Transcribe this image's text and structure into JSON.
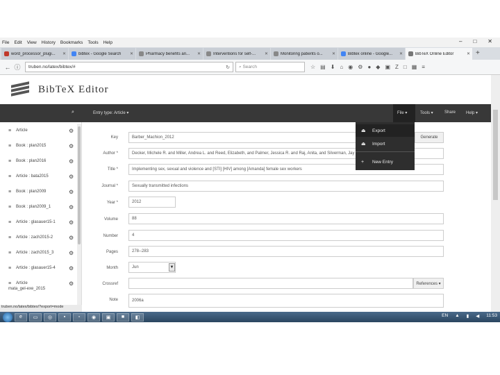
{
  "browser": {
    "menu": [
      "File",
      "Edit",
      "View",
      "History",
      "Bookmarks",
      "Tools",
      "Help"
    ],
    "tabs": [
      {
        "label": "word_processor_plugi...",
        "color": "#c0392b"
      },
      {
        "label": "bibtex - Google Search",
        "color": "#4285f4"
      },
      {
        "label": "Pharmacy benefits an...",
        "color": "#888888"
      },
      {
        "label": "Interventions for self-...",
        "color": "#888888"
      },
      {
        "label": "Monitoring patients o...",
        "color": "#888888"
      },
      {
        "label": "Bibtex online - Google...",
        "color": "#4285f4"
      },
      {
        "label": "BibTeX Online Editor",
        "color": "#777777"
      }
    ],
    "url": "truben.no/latex/bibtex/#",
    "search_placeholder": "Search"
  },
  "app": {
    "title": "BibTeX Editor",
    "entry_type_label": "Entry type: Article ▾",
    "nav": {
      "file": "File ▾",
      "tools": "Tools ▾",
      "share": "Share",
      "help": "Help ▾"
    },
    "file_menu": {
      "export": "Export",
      "import": "Import",
      "new_entry": "New Entry"
    }
  },
  "entries": [
    {
      "label": "Article"
    },
    {
      "label": "Book : plan2015"
    },
    {
      "label": "Book : plan2016"
    },
    {
      "label": "Article : bata2015"
    },
    {
      "label": "Book : plan2009"
    },
    {
      "label": "Book : plan2009_1"
    },
    {
      "label": "Article : glasauer15-1"
    },
    {
      "label": "Article : zach2015-2"
    },
    {
      "label": "Article : zach2015_3"
    },
    {
      "label": "Article : glasauer15-4"
    },
    {
      "label": "Article",
      "sub": "mata_gel-exe_2015"
    }
  ],
  "form": {
    "key_label": "Key",
    "key_value": "Barber_Machion_2012",
    "generate_label": "Generate",
    "author_label": "Author *",
    "author_value": "Decker, Michele R. and Miller, Andrea L. and Reed, Elizabeth, and Palmer, Jessica R. and Raj, Anita, and Silverman, Jay G. and Decker, Michele R.",
    "title_label": "Title *",
    "title_value": "Implementing sex, sexual and violence and [STI] [HIV] among [Amanda] female sex workers",
    "journal_label": "Journal *",
    "journal_value": "Sexually transmitted infections",
    "year_label": "Year *",
    "year_value": "2012",
    "volume_label": "Volume",
    "volume_value": "88",
    "number_label": "Number",
    "number_value": "4",
    "pages_label": "Pages",
    "pages_value": "278--283",
    "month_label": "Month",
    "month_value": "Jun",
    "crossref_label": "Crossref",
    "references_label": "References ▾",
    "note_label": "Note",
    "note_value": "2006a"
  },
  "status_link": "truben.no/latex/bibtex/?export=mode",
  "tray": {
    "lang": "EN",
    "time": "11:53"
  }
}
